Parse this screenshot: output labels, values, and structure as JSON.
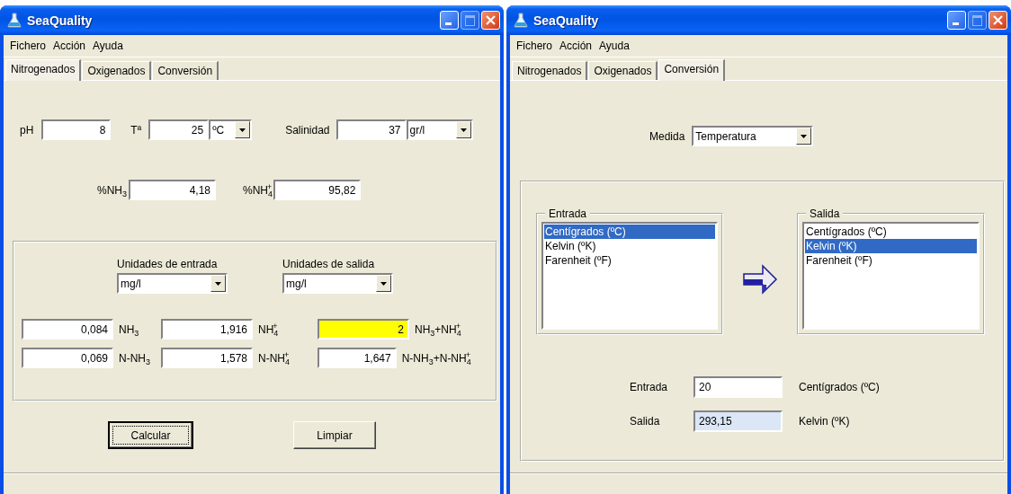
{
  "windows": [
    {
      "title": "SeaQuality",
      "menu": [
        "Fichero",
        "Acción",
        "Ayuda"
      ],
      "tabs": [
        {
          "label": "Nitrogenados",
          "selected": true
        },
        {
          "label": "Oxigenados",
          "selected": false
        },
        {
          "label": "Conversión",
          "selected": false
        }
      ],
      "panel": {
        "kind": "nitrogenados",
        "parameters": [
          {
            "label": "pH",
            "value": "8"
          },
          {
            "label": "Tª",
            "value": "25",
            "unit": "ºC"
          },
          {
            "label": "Salinidad",
            "value": "37",
            "unit": "gr/l"
          }
        ],
        "percentages": [
          {
            "label": "%NH$_{3}$",
            "value": "4,18"
          },
          {
            "label": "%NH$_{4}$$^{+}$",
            "value": "95,82"
          }
        ],
        "units": [
          {
            "label": "Unidades de entrada",
            "value": "mg/l"
          },
          {
            "label": "Unidades de salida",
            "value": "mg/l"
          }
        ],
        "results": [
          [
            {
              "value": "0,084",
              "label": "NH$_{3}$",
              "highlighted": false
            },
            {
              "value": "1,916",
              "label": "NH$_{4}$$^{+}$",
              "highlighted": false
            },
            {
              "value": "2",
              "label": "NH$_{3}$+NH$_{4}$$^{+}$",
              "highlighted": true
            }
          ],
          [
            {
              "value": "0,069",
              "label": "N-NH$_{3}$",
              "highlighted": false
            },
            {
              "value": "1,578",
              "label": "N-NH$_{4}$$^{+}$",
              "highlighted": false
            },
            {
              "value": "1,647",
              "label": "N-NH$_{3}$+N-NH$_{4}$$^{+}$",
              "highlighted": false
            }
          ]
        ],
        "actions": [
          {
            "label": "Calcular",
            "focused": true
          },
          {
            "label": "Limpiar",
            "focused": false
          }
        ]
      }
    },
    {
      "title": "SeaQuality",
      "menu": [
        "Fichero",
        "Acción",
        "Ayuda"
      ],
      "tabs": [
        {
          "label": "Nitrogenados",
          "selected": false
        },
        {
          "label": "Oxigenados",
          "selected": false
        },
        {
          "label": "Conversión",
          "selected": true
        }
      ],
      "panel": {
        "kind": "conversion",
        "measure": {
          "label": "Medida",
          "value": "Temperatura"
        },
        "lists": [
          {
            "legend": "Entrada",
            "items": [
              {
                "label": "Centígrados (ºC)",
                "selected": true
              },
              {
                "label": "Kelvin (ºK)",
                "selected": false
              },
              {
                "label": "Farenheit (ºF)",
                "selected": false
              }
            ]
          },
          {
            "legend": "Salida",
            "items": [
              {
                "label": "Centígrados (ºC)",
                "selected": false
              },
              {
                "label": "Kelvin (ºK)",
                "selected": true
              },
              {
                "label": "Farenheit (ºF)",
                "selected": false
              }
            ]
          }
        ],
        "fields": [
          {
            "label": "Entrada",
            "value": "20",
            "unit": "Centígrados (ºC)",
            "readonly": false
          },
          {
            "label": "Salida",
            "value": "293,15",
            "unit": "Kelvin (ºK)",
            "readonly": true
          }
        ]
      }
    }
  ]
}
